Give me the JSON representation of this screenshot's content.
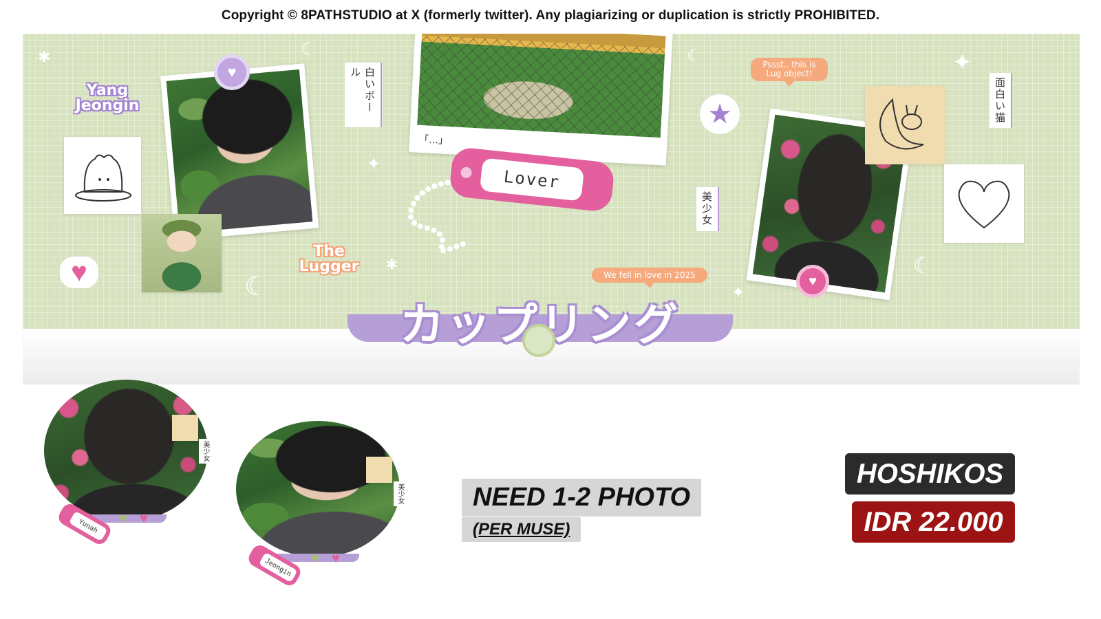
{
  "header": {
    "copyright": "Copyright © 8PATHSTUDIO at X (formerly twitter). Any plagiarizing or duplication is strictly PROHIBITED."
  },
  "banner": {
    "name_left": "Yang Jeongin",
    "lugger_label": "The Lugger",
    "vertical_text_1": "白いボール",
    "vertical_text_2": "美少女",
    "vertical_text_3": "面白い猫",
    "caption": "「…」",
    "tag_label": "Lover",
    "speech_top": "Pssst.. this is Lug object!",
    "speech_bottom": "We fell in love in 2025",
    "title": "カップリング"
  },
  "previews": {
    "left_tag": "Yunah",
    "right_tag": "Jeongin"
  },
  "info": {
    "need": "NEED 1-2 PHOTO",
    "per_muse": "(PER MUSE)",
    "shop": "HOSHIKOS",
    "price": "IDR 22.000"
  },
  "colors": {
    "banner_green": "#d7e2bf",
    "accent_purple": "#b69fd6",
    "accent_pink": "#e35f9d",
    "accent_orange": "#f5a97c",
    "price_red": "#9c1313"
  }
}
